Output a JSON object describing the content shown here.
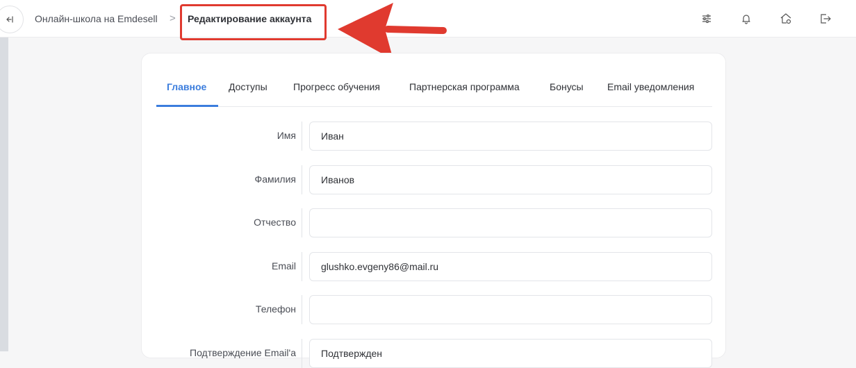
{
  "header": {
    "breadcrumb_parent": "Онлайн-школа на Emdesell",
    "breadcrumb_separator": ">",
    "breadcrumb_current": "Редактирование аккаунта",
    "icons": [
      "collapse-sidebar-icon",
      "settings-sliders-icon",
      "bell-icon",
      "home-settings-icon",
      "logout-icon"
    ]
  },
  "annotation": {
    "highlight_color": "#e03a2f"
  },
  "tabs": [
    {
      "label": "Главное",
      "active": true
    },
    {
      "label": "Доступы"
    },
    {
      "label": "Прогресс обучения"
    },
    {
      "label": "Партнерская программа"
    },
    {
      "label": "Бонусы"
    },
    {
      "label": "Email уведомления"
    }
  ],
  "form": {
    "first_name": {
      "label": "Имя",
      "value": "Иван"
    },
    "last_name": {
      "label": "Фамилия",
      "value": "Иванов"
    },
    "middle_name": {
      "label": "Отчество",
      "value": ""
    },
    "email": {
      "label": "Email",
      "value": "glushko.evgeny86@mail.ru"
    },
    "phone": {
      "label": "Телефон",
      "value": ""
    },
    "email_confirm": {
      "label": "Подтверждение Email'а",
      "value": "Подтвержден"
    }
  },
  "colors": {
    "accent": "#3b7ddd",
    "annotation": "#e03a2f"
  }
}
